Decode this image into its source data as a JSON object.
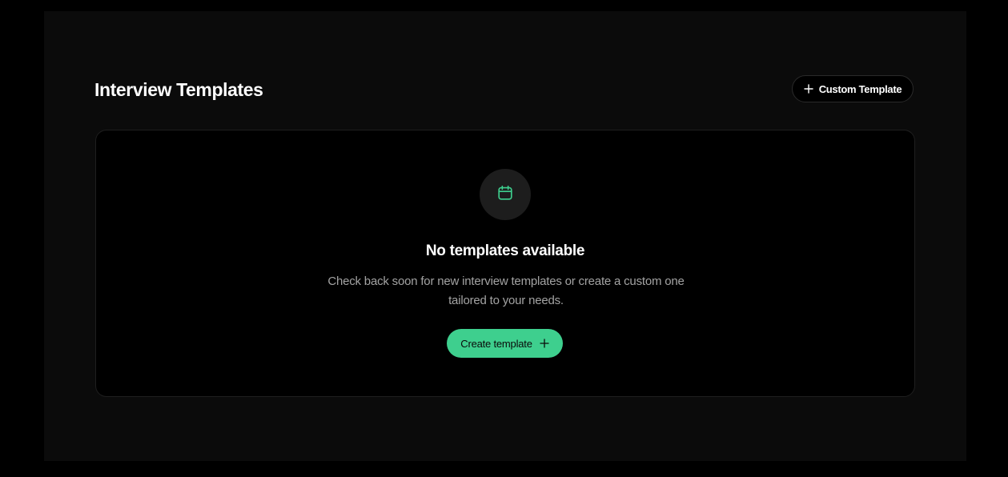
{
  "header": {
    "title": "Interview Templates",
    "custom_template_label": "Custom Template",
    "custom_template_icon": "plus-icon"
  },
  "empty_state": {
    "icon": "calendar-icon",
    "title": "No templates available",
    "description": "Check back soon for new interview templates or create a custom one tailored to your needs.",
    "create_label": "Create template",
    "create_icon": "plus-icon"
  },
  "colors": {
    "accent": "#3ecf8e",
    "background": "#000000",
    "panel": "#0b0b0b",
    "icon_circle": "#1d1d1d"
  }
}
